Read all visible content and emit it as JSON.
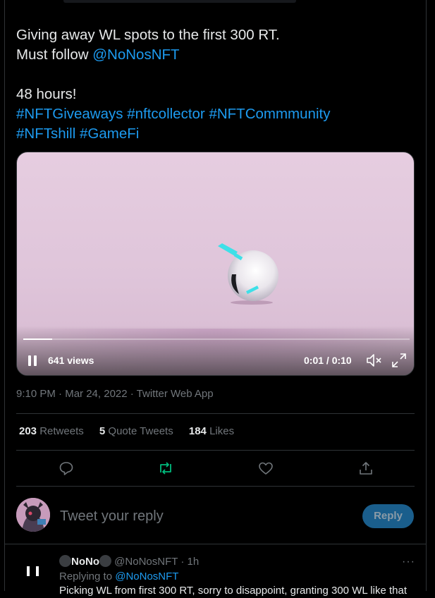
{
  "tweet": {
    "line1": "Giving away WL spots to the first 300 RT.",
    "line2_prefix": "Must follow ",
    "line2_mention": "@NoNosNFT",
    "line3": "48 hours!",
    "hashtags_row1": [
      "#NFTGiveaways",
      "#nftcollector",
      "#NFTCommmunity"
    ],
    "hashtags_row2": [
      "#NFTshill",
      "#GameFi"
    ]
  },
  "video": {
    "views": "641 views",
    "time": "0:01 / 0:10",
    "progress": 0.075,
    "pause_icon": "pause-icon",
    "mute_icon": "muted-speaker-icon",
    "fullscreen_icon": "fullscreen-icon"
  },
  "meta": {
    "time": "9:10 PM",
    "date": "Mar 24, 2022",
    "source": "Twitter Web App"
  },
  "stats": {
    "retweets_count": "203",
    "retweets_label": "Retweets",
    "quotes_count": "5",
    "quotes_label": "Quote Tweets",
    "likes_count": "184",
    "likes_label": "Likes"
  },
  "actions": [
    "reply-icon",
    "retweet-icon",
    "like-icon",
    "share-icon"
  ],
  "colors": {
    "link": "#1d9bf0",
    "retweet": "#00ba7c",
    "reply_button": "#1a5e8c"
  },
  "composer": {
    "placeholder": "Tweet your reply",
    "button": "Reply"
  },
  "reply": {
    "name": "NoNo",
    "handle": "@NoNosNFT",
    "age": "· 1h",
    "replying_prefix": "Replying to ",
    "replying_to": "@NoNosNFT",
    "text": "Picking WL from first 300 RT, sorry to disappoint, granting 300 WL like that"
  }
}
